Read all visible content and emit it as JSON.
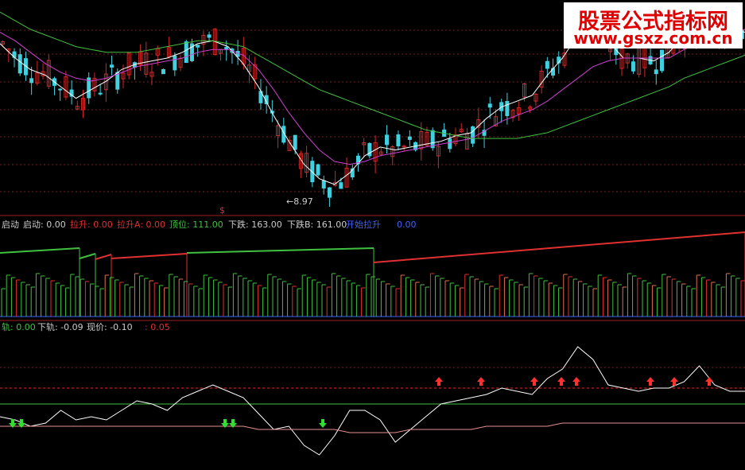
{
  "watermark": {
    "title": "股票公式指标网",
    "url": "www.gsxz.com.cn"
  },
  "colors": {
    "background": "#000000",
    "up": "#d02828",
    "down": "#40d0e0",
    "ma_white": "#ffffff",
    "ma_purple": "#d040d0",
    "ma_green": "#40c040",
    "grid": "#7a2020",
    "green_line": "#40c040",
    "red_line": "#e03030",
    "blue_line": "#4060ff",
    "pink_line": "#e89090"
  },
  "panel1": {
    "low_label": "8.97",
    "marker": "$"
  },
  "panel2": {
    "legend": [
      {
        "text": "启动",
        "color": "#cccccc"
      },
      {
        "text": "启动: 0.00",
        "color": "#cccccc"
      },
      {
        "text": "拉升: 0.00",
        "color": "#e03030"
      },
      {
        "text": "拉升A: 0.00",
        "color": "#e03030"
      },
      {
        "text": "顶位: 111.00",
        "color": "#40c040"
      },
      {
        "text": "下跌: 163.00",
        "color": "#cccccc"
      },
      {
        "text": "下跌B: 161.00",
        "color": "#cccccc"
      },
      {
        "text": "开始拉升",
        "color": "#4060ff"
      },
      {
        "text": "0.00",
        "color": "#4060ff"
      }
    ]
  },
  "panel3": {
    "legend": [
      {
        "text": "轨: 0.00",
        "color": "#40c040"
      },
      {
        "text": "下轨: -0.09",
        "color": "#cccccc"
      },
      {
        "text": "现价: -0.10",
        "color": "#cccccc"
      },
      {
        "text": ": 0.05",
        "color": "#e03030"
      }
    ]
  },
  "chart_data": [
    {
      "type": "candlestick",
      "title": "",
      "panel": "price",
      "ylim": [
        8.6,
        12.2
      ],
      "series": [
        {
          "name": "",
          "color": "#ffffff",
          "values": [
            11.55,
            11.3,
            11.1,
            11.0,
            10.8,
            10.6,
            10.75,
            10.9,
            11.1,
            11.2,
            11.25,
            11.3,
            11.4,
            11.55,
            11.6,
            11.5,
            11.2,
            10.8,
            10.3,
            9.85,
            9.45,
            9.2,
            9.1,
            9.3,
            9.6,
            9.75,
            9.7,
            9.75,
            9.8,
            9.85,
            9.95,
            10.0,
            10.25,
            10.45,
            10.55,
            10.65,
            11.0,
            11.3,
            11.7,
            11.9,
            11.6,
            11.3,
            11.3,
            11.25,
            11.4,
            11.7,
            11.8,
            11.8,
            11.8,
            11.75
          ]
        },
        {
          "name": "",
          "color": "#d040d0",
          "values": [
            11.75,
            11.6,
            11.4,
            11.2,
            11.05,
            10.95,
            10.9,
            10.95,
            11.05,
            11.15,
            11.2,
            11.25,
            11.3,
            11.4,
            11.45,
            11.45,
            11.35,
            11.1,
            10.75,
            10.35,
            10.0,
            9.7,
            9.5,
            9.45,
            9.5,
            9.6,
            9.65,
            9.7,
            9.75,
            9.8,
            9.85,
            9.9,
            10.05,
            10.2,
            10.3,
            10.4,
            10.55,
            10.75,
            10.95,
            11.15,
            11.25,
            11.3,
            11.3,
            11.3,
            11.3,
            11.45,
            11.6,
            11.7,
            11.75,
            11.8
          ]
        },
        {
          "name": "",
          "color": "#40c040",
          "values": [
            12.1,
            11.95,
            11.8,
            11.7,
            11.6,
            11.5,
            11.45,
            11.4,
            11.4,
            11.4,
            11.45,
            11.5,
            11.55,
            11.6,
            11.6,
            11.55,
            11.5,
            11.35,
            11.2,
            11.05,
            10.9,
            10.75,
            10.65,
            10.55,
            10.45,
            10.35,
            10.25,
            10.15,
            10.05,
            10.0,
            9.95,
            9.9,
            9.9,
            9.9,
            9.9,
            9.95,
            10.0,
            10.1,
            10.2,
            10.3,
            10.4,
            10.5,
            10.6,
            10.7,
            10.8,
            10.95,
            11.05,
            11.15,
            11.25,
            11.35
          ]
        }
      ]
    },
    {
      "type": "line",
      "panel": "oscillator",
      "reference_lines": [
        0.05,
        0.0
      ],
      "series": [
        {
          "name": "",
          "color": "#ffffff",
          "values": [
            -0.04,
            -0.05,
            -0.07,
            -0.06,
            -0.02,
            -0.05,
            -0.04,
            -0.05,
            -0.02,
            0.01,
            0.0,
            -0.02,
            0.02,
            0.04,
            0.06,
            0.04,
            0.02,
            -0.03,
            -0.08,
            -0.07,
            -0.13,
            -0.16,
            -0.1,
            -0.02,
            -0.02,
            -0.05,
            -0.12,
            -0.08,
            -0.04,
            0.0,
            0.01,
            0.02,
            0.03,
            0.05,
            0.04,
            0.03,
            0.08,
            0.11,
            0.18,
            0.14,
            0.06,
            0.05,
            0.04,
            0.05,
            0.05,
            0.07,
            0.12,
            0.06,
            0.04,
            0.04
          ]
        },
        {
          "name": "",
          "color": "#e89090",
          "values": [
            -0.07,
            -0.07,
            -0.07,
            -0.07,
            -0.07,
            -0.07,
            -0.07,
            -0.07,
            -0.07,
            -0.07,
            -0.07,
            -0.07,
            -0.07,
            -0.07,
            -0.07,
            -0.07,
            -0.07,
            -0.08,
            -0.08,
            -0.08,
            -0.08,
            -0.08,
            -0.08,
            -0.09,
            -0.09,
            -0.09,
            -0.09,
            -0.08,
            -0.08,
            -0.08,
            -0.08,
            -0.08,
            -0.07,
            -0.07,
            -0.07,
            -0.07,
            -0.07,
            -0.06,
            -0.06,
            -0.06,
            -0.06,
            -0.06,
            -0.06,
            -0.06,
            -0.06,
            -0.06,
            -0.06,
            -0.06,
            -0.06,
            -0.06
          ]
        }
      ]
    }
  ]
}
